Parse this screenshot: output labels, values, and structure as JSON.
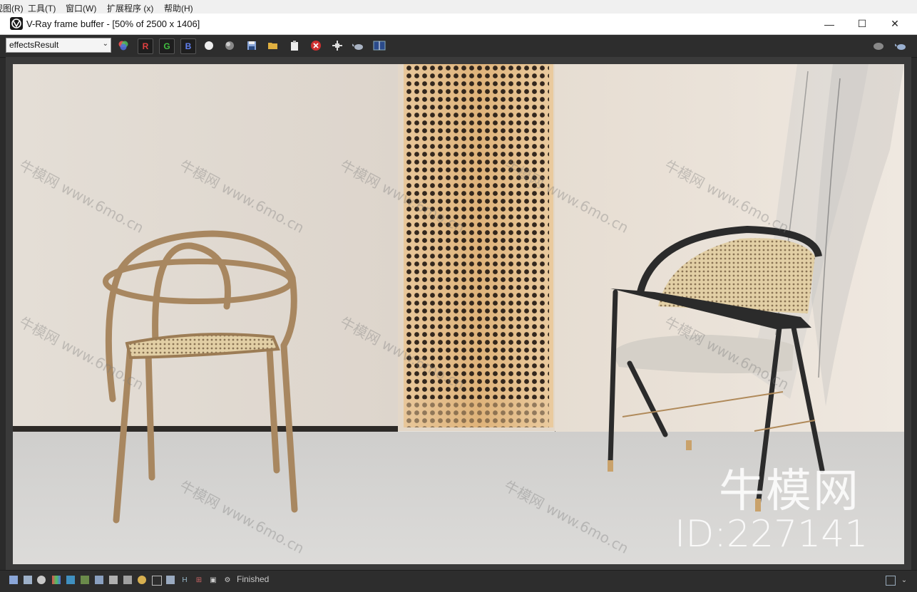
{
  "menubar": {
    "items": [
      "视图(R)",
      "工具(T)",
      "窗口(W)",
      "扩展程序 (x)",
      "帮助(H)"
    ]
  },
  "window": {
    "title": "V-Ray frame buffer - [50% of 2500 x 1406]",
    "minimize": "—",
    "maximize": "☐",
    "close": "✕"
  },
  "toolbar": {
    "channel_value": "effectsResult",
    "channel_chevron": "⌄",
    "r_label": "R",
    "g_label": "G",
    "b_label": "B"
  },
  "status": {
    "text": "Finished"
  },
  "watermark": {
    "brand": "牛模网",
    "url": "www.6mo.cn",
    "id": "ID:227141"
  },
  "colors": {
    "toolbar_bg": "#2d2d2d",
    "titlebar_bg": "#ffffff",
    "render_wall": "#e9e3dc",
    "render_floor": "#d4d3d1"
  }
}
